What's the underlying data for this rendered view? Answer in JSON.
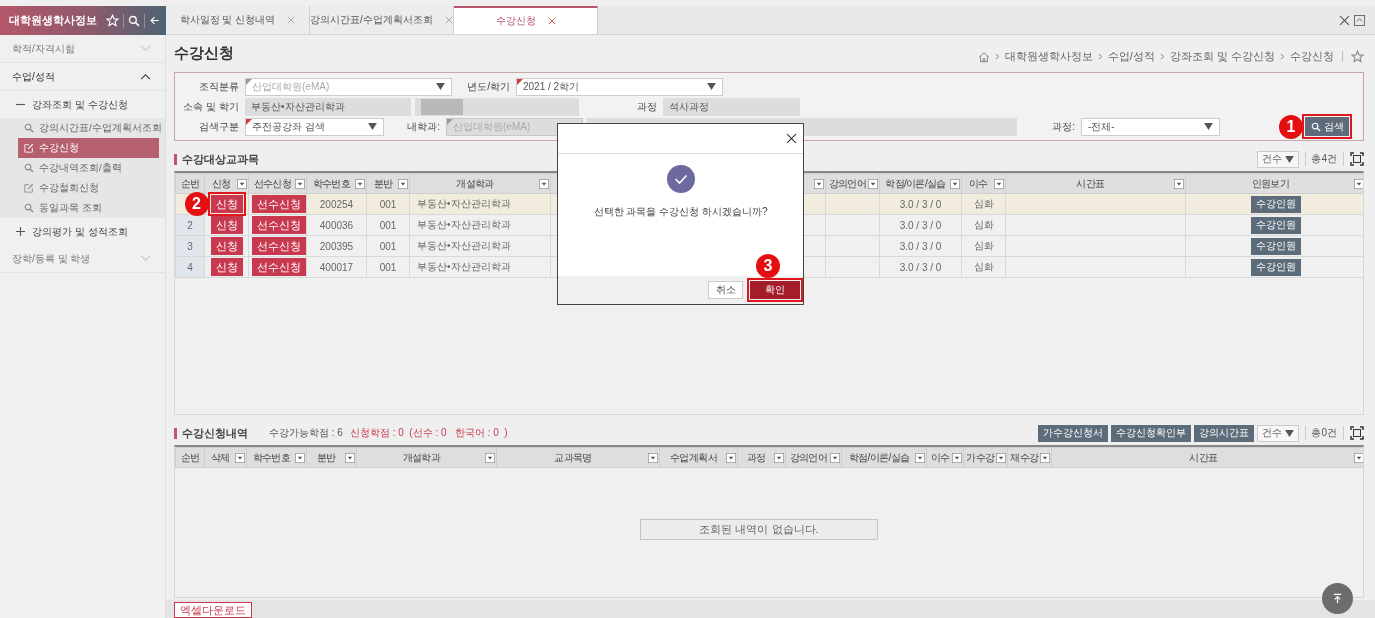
{
  "sidebar": {
    "title": "대학원생학사정보",
    "items": [
      {
        "label": "학적/자격시험",
        "expanded": false
      },
      {
        "label": "수업/성적",
        "expanded": true,
        "children": [
          {
            "label": "강좌조회 및 수강신청",
            "expanded": true,
            "children": [
              {
                "label": "강의시간표/수업계획서조회",
                "kind": "search",
                "selected": false
              },
              {
                "label": "수강신청",
                "kind": "edit",
                "selected": true
              },
              {
                "label": "수강내역조회/출력",
                "kind": "search",
                "selected": false
              },
              {
                "label": "수강철회신청",
                "kind": "edit",
                "selected": false
              },
              {
                "label": "동일과목 조회",
                "kind": "search",
                "selected": false
              }
            ]
          },
          {
            "label": "강의평가 및 성적조회",
            "expanded": false
          }
        ]
      },
      {
        "label": "장학/등록 및 학생",
        "expanded": false
      }
    ]
  },
  "tabs": [
    {
      "label": "학사일정 및 신청내역",
      "selected": false
    },
    {
      "label": "강의시간표/수업계획서조회",
      "selected": false
    },
    {
      "label": "수강신청",
      "selected": true
    }
  ],
  "page": {
    "title": "수강신청",
    "breadcrumb": [
      "대학원생학사정보",
      "수업/성적",
      "강좌조회 및 수강신청",
      "수강신청"
    ]
  },
  "search_form": {
    "rows": [
      [
        {
          "kind": "label",
          "text": "조직분류"
        },
        {
          "kind": "select",
          "value": "산업대학원(eMA)",
          "disabled": true,
          "required": false
        },
        {
          "kind": "label",
          "text": "년도/학기"
        },
        {
          "kind": "select",
          "value": "2021 / 2학기",
          "disabled": false,
          "required": true
        }
      ],
      [
        {
          "kind": "label",
          "text": "소속 및 학기"
        },
        {
          "kind": "text",
          "value": "부동산•자산관리학과",
          "disabled": false,
          "required": false
        },
        {
          "kind": "masked"
        },
        {
          "kind": "label",
          "text": "과정"
        },
        {
          "kind": "text",
          "value": "석사과정",
          "disabled": false,
          "required": false
        }
      ],
      [
        {
          "kind": "label",
          "text": "검색구분"
        },
        {
          "kind": "select",
          "value": "주전공강좌 검색",
          "disabled": false,
          "required": true
        },
        {
          "kind": "label",
          "text": "내학과:"
        },
        {
          "kind": "text",
          "value": "산업대학원(eMA)",
          "disabled": true,
          "required": false
        },
        {
          "kind": "text"
        },
        {
          "kind": "label",
          "text": "과정:"
        },
        {
          "kind": "select",
          "value": "-전체-",
          "disabled": false,
          "required": false
        },
        {
          "kind": "button",
          "text": "검색",
          "callout": "1"
        }
      ]
    ]
  },
  "course_list": {
    "title": "수강대상교과목",
    "count_select": "건수",
    "total": "총4건",
    "columns": [
      {
        "label": "순번",
        "filter": false
      },
      {
        "label": "신청",
        "filter": true
      },
      {
        "label": "선수신청",
        "filter": true
      },
      {
        "label": "학수번호",
        "filter": true
      },
      {
        "label": "분반",
        "filter": true
      },
      {
        "label": "개설학과",
        "filter": true
      },
      {
        "filter": true
      },
      {
        "label": "강의언어",
        "filter": true
      },
      {
        "label": "학점/이론/실습",
        "filter": true
      },
      {
        "label": "이수",
        "filter": true
      },
      {
        "label": "시간표",
        "filter": true
      },
      {
        "label": "인원보기",
        "filter": true
      }
    ],
    "rows": [
      {
        "selected": true,
        "cells": [
          {
            "kind": "text"
          },
          {
            "kind": "action",
            "text": "신청",
            "callout": "2"
          },
          {
            "kind": "action",
            "text": "선수신청"
          },
          {
            "kind": "text",
            "text": "200254"
          },
          {
            "kind": "text",
            "text": "001"
          },
          {
            "kind": "text",
            "text": "부동산•자산관리학과"
          },
          {
            "kind": "text"
          },
          {
            "kind": "text"
          },
          {
            "kind": "text",
            "text": "3.0 / 3 / 0"
          },
          {
            "kind": "text",
            "text": "심화"
          },
          {
            "kind": "text"
          },
          {
            "kind": "info",
            "text": "수강인원"
          }
        ]
      },
      {
        "selected": false,
        "cells": [
          {
            "kind": "text",
            "text": "2"
          },
          {
            "kind": "action",
            "text": "신청"
          },
          {
            "kind": "action",
            "text": "선수신청"
          },
          {
            "kind": "text",
            "text": "400036"
          },
          {
            "kind": "text",
            "text": "001"
          },
          {
            "kind": "text",
            "text": "부동산•자산관리학과"
          },
          {
            "kind": "text"
          },
          {
            "kind": "text"
          },
          {
            "kind": "text",
            "text": "3.0 / 3 / 0"
          },
          {
            "kind": "text",
            "text": "심화"
          },
          {
            "kind": "text"
          },
          {
            "kind": "info",
            "text": "수강인원"
          }
        ]
      },
      {
        "selected": false,
        "cells": [
          {
            "kind": "text",
            "text": "3"
          },
          {
            "kind": "action",
            "text": "신청"
          },
          {
            "kind": "action",
            "text": "선수신청"
          },
          {
            "kind": "text",
            "text": "200395"
          },
          {
            "kind": "text",
            "text": "001"
          },
          {
            "kind": "text",
            "text": "부동산•자산관리학과"
          },
          {
            "kind": "text"
          },
          {
            "kind": "text"
          },
          {
            "kind": "text",
            "text": "3.0 / 3 / 0"
          },
          {
            "kind": "text",
            "text": "심화"
          },
          {
            "kind": "text"
          },
          {
            "kind": "info",
            "text": "수강인원"
          }
        ]
      },
      {
        "selected": false,
        "cells": [
          {
            "kind": "text",
            "text": "4"
          },
          {
            "kind": "action",
            "text": "신청"
          },
          {
            "kind": "action",
            "text": "선수신청"
          },
          {
            "kind": "text",
            "text": "400017"
          },
          {
            "kind": "text",
            "text": "001"
          },
          {
            "kind": "text",
            "text": "부동산•자산관리학과"
          },
          {
            "kind": "text"
          },
          {
            "kind": "text"
          },
          {
            "kind": "text",
            "text": "3.0 / 3 / 0"
          },
          {
            "kind": "text",
            "text": "심화"
          },
          {
            "kind": "text"
          },
          {
            "kind": "info",
            "text": "수강인원"
          }
        ]
      }
    ]
  },
  "enrollment": {
    "title": "수강신청내역",
    "available_credits": "수강가능학점 : 6",
    "applied_summary": "신청학점 : 0  (선수 : 0   한국어 : 0  )",
    "buttons": [
      "가수강신청서",
      "수강신청확인부",
      "강의시간표"
    ],
    "count_select": "건수",
    "total": "총0건",
    "columns": [
      {
        "label": "순번",
        "filter": false
      },
      {
        "label": "삭제",
        "filter": true
      },
      {
        "label": "학수번호",
        "filter": true
      },
      {
        "label": "분반",
        "filter": true
      },
      {
        "label": "개설학과",
        "filter": true
      },
      {
        "label": "교과목명",
        "filter": true
      },
      {
        "label": "수업계획서",
        "filter": true
      },
      {
        "label": "과정",
        "filter": true
      },
      {
        "label": "강의언어",
        "filter": true
      },
      {
        "label": "학점/이론/실습",
        "filter": true
      },
      {
        "label": "이수",
        "filter": true
      },
      {
        "label": "가수강",
        "filter": true
      },
      {
        "label": "재수강",
        "filter": true
      },
      {
        "label": "시간표",
        "filter": true
      }
    ],
    "empty_message": "조회된 내역이 없습니다."
  },
  "excel_button": "엑셀다운로드",
  "dialog": {
    "message": "선택한 과목을 수강신청 하시겠습니까?",
    "buttons": [
      {
        "label": "취소",
        "kind": "secondary"
      },
      {
        "label": "확인",
        "kind": "primary",
        "callout": "3"
      }
    ]
  }
}
